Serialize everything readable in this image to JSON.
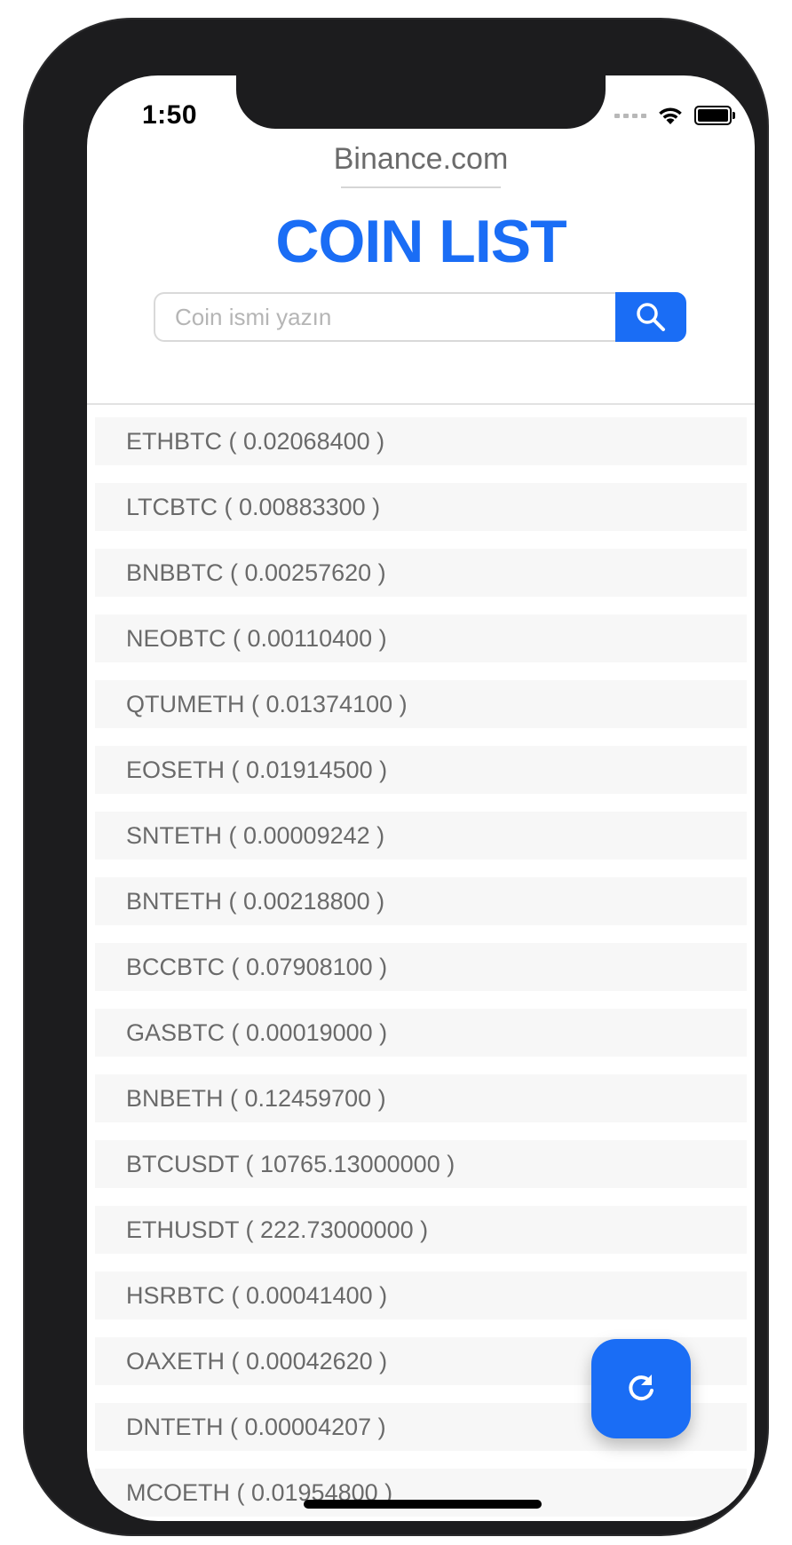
{
  "status_bar": {
    "time": "1:50"
  },
  "header": {
    "site": "Binance.com",
    "title": "COIN LIST"
  },
  "search": {
    "placeholder": "Coin ismi yazın",
    "value": ""
  },
  "coins": [
    "ETHBTC ( 0.02068400 )",
    "LTCBTC ( 0.00883300 )",
    "BNBBTC ( 0.00257620 )",
    "NEOBTC ( 0.00110400 )",
    "QTUMETH ( 0.01374100 )",
    "EOSETH ( 0.01914500 )",
    "SNTETH ( 0.00009242 )",
    "BNTETH ( 0.00218800 )",
    "BCCBTC ( 0.07908100 )",
    "GASBTC ( 0.00019000 )",
    "BNBETH ( 0.12459700 )",
    "BTCUSDT ( 10765.13000000 )",
    "ETHUSDT ( 222.73000000 )",
    "HSRBTC ( 0.00041400 )",
    "OAXETH ( 0.00042620 )",
    "DNTETH ( 0.00004207 )",
    "MCOETH ( 0.01954800 )"
  ],
  "colors": {
    "accent": "#1a6df5",
    "row_bg": "#f7f7f7",
    "row_text": "#6a6a6a",
    "frame": "#1c1c1e"
  },
  "icons": {
    "search": "search-icon",
    "refresh": "refresh-icon",
    "wifi": "wifi-icon",
    "battery": "battery-icon",
    "signal": "signal-icon"
  }
}
